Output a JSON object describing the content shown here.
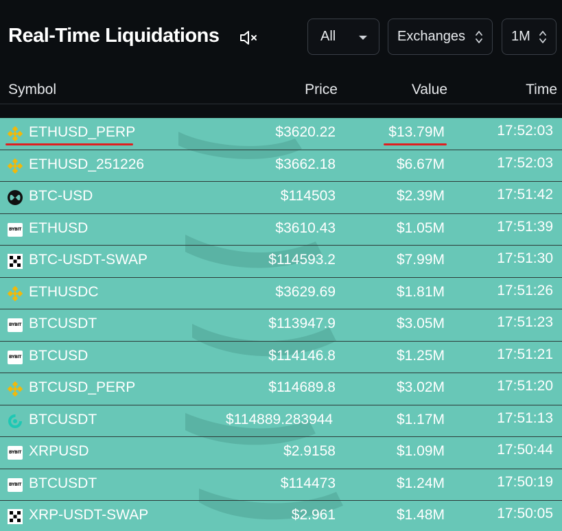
{
  "header": {
    "title": "Real-Time Liquidations",
    "filter_all": "All",
    "filter_exchanges": "Exchanges",
    "filter_timeframe": "1M"
  },
  "columns": {
    "symbol": "Symbol",
    "price": "Price",
    "value": "Value",
    "time": "Time"
  },
  "colors": {
    "row_background": "#68c7b7",
    "page_background": "#0b0e11",
    "highlight_underline": "#e01e1e",
    "binance_icon": "#f0b90b",
    "crypto_com_icon": "#1ec8b4"
  },
  "rows": [
    {
      "exchange_icon": "binance-icon",
      "symbol": "ETHUSD_PERP",
      "price": "$3620.22",
      "value": "$13.79M",
      "time": "17:52:03"
    },
    {
      "exchange_icon": "binance-icon",
      "symbol": "ETHUSD_251226",
      "price": "$3662.18",
      "value": "$6.67M",
      "time": "17:52:03"
    },
    {
      "exchange_icon": "bitmex-icon",
      "symbol": "BTC-USD",
      "price": "$114503",
      "value": "$2.39M",
      "time": "17:51:42"
    },
    {
      "exchange_icon": "bybit-icon",
      "symbol": "ETHUSD",
      "price": "$3610.43",
      "value": "$1.05M",
      "time": "17:51:39"
    },
    {
      "exchange_icon": "okx-icon",
      "symbol": "BTC-USDT-SWAP",
      "price": "$114593.2",
      "value": "$7.99M",
      "time": "17:51:30"
    },
    {
      "exchange_icon": "binance-icon",
      "symbol": "ETHUSDC",
      "price": "$3629.69",
      "value": "$1.81M",
      "time": "17:51:26"
    },
    {
      "exchange_icon": "bybit-icon",
      "symbol": "BTCUSDT",
      "price": "$113947.9",
      "value": "$3.05M",
      "time": "17:51:23"
    },
    {
      "exchange_icon": "bybit-icon",
      "symbol": "BTCUSD",
      "price": "$114146.8",
      "value": "$1.25M",
      "time": "17:51:21"
    },
    {
      "exchange_icon": "binance-icon",
      "symbol": "BTCUSD_PERP",
      "price": "$114689.8",
      "value": "$3.02M",
      "time": "17:51:20"
    },
    {
      "exchange_icon": "crypto-com-icon",
      "symbol": "BTCUSDT",
      "price": "$114889.283944",
      "value": "$1.17M",
      "time": "17:51:13"
    },
    {
      "exchange_icon": "bybit-icon",
      "symbol": "XRPUSD",
      "price": "$2.9158",
      "value": "$1.09M",
      "time": "17:50:44"
    },
    {
      "exchange_icon": "bybit-icon",
      "symbol": "BTCUSDT",
      "price": "$114473",
      "value": "$1.24M",
      "time": "17:50:19"
    },
    {
      "exchange_icon": "okx-icon",
      "symbol": "XRP-USDT-SWAP",
      "price": "$2.961",
      "value": "$1.48M",
      "time": "17:50:05"
    }
  ],
  "bybit_logo_text": "BYBIT"
}
